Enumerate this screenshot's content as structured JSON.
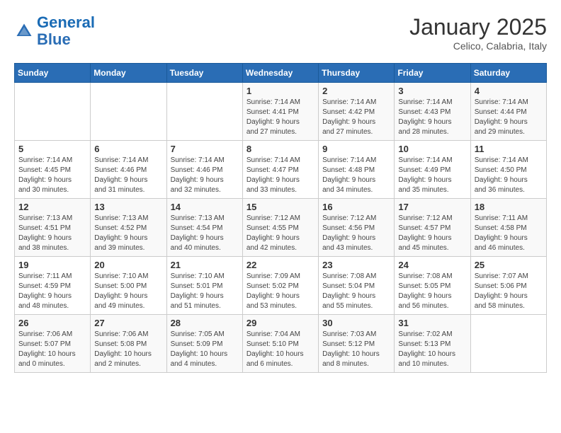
{
  "logo": {
    "line1": "General",
    "line2": "Blue"
  },
  "title": "January 2025",
  "location": "Celico, Calabria, Italy",
  "weekdays": [
    "Sunday",
    "Monday",
    "Tuesday",
    "Wednesday",
    "Thursday",
    "Friday",
    "Saturday"
  ],
  "weeks": [
    [
      {
        "day": "",
        "info": ""
      },
      {
        "day": "",
        "info": ""
      },
      {
        "day": "",
        "info": ""
      },
      {
        "day": "1",
        "info": "Sunrise: 7:14 AM\nSunset: 4:41 PM\nDaylight: 9 hours\nand 27 minutes."
      },
      {
        "day": "2",
        "info": "Sunrise: 7:14 AM\nSunset: 4:42 PM\nDaylight: 9 hours\nand 27 minutes."
      },
      {
        "day": "3",
        "info": "Sunrise: 7:14 AM\nSunset: 4:43 PM\nDaylight: 9 hours\nand 28 minutes."
      },
      {
        "day": "4",
        "info": "Sunrise: 7:14 AM\nSunset: 4:44 PM\nDaylight: 9 hours\nand 29 minutes."
      }
    ],
    [
      {
        "day": "5",
        "info": "Sunrise: 7:14 AM\nSunset: 4:45 PM\nDaylight: 9 hours\nand 30 minutes."
      },
      {
        "day": "6",
        "info": "Sunrise: 7:14 AM\nSunset: 4:46 PM\nDaylight: 9 hours\nand 31 minutes."
      },
      {
        "day": "7",
        "info": "Sunrise: 7:14 AM\nSunset: 4:46 PM\nDaylight: 9 hours\nand 32 minutes."
      },
      {
        "day": "8",
        "info": "Sunrise: 7:14 AM\nSunset: 4:47 PM\nDaylight: 9 hours\nand 33 minutes."
      },
      {
        "day": "9",
        "info": "Sunrise: 7:14 AM\nSunset: 4:48 PM\nDaylight: 9 hours\nand 34 minutes."
      },
      {
        "day": "10",
        "info": "Sunrise: 7:14 AM\nSunset: 4:49 PM\nDaylight: 9 hours\nand 35 minutes."
      },
      {
        "day": "11",
        "info": "Sunrise: 7:14 AM\nSunset: 4:50 PM\nDaylight: 9 hours\nand 36 minutes."
      }
    ],
    [
      {
        "day": "12",
        "info": "Sunrise: 7:13 AM\nSunset: 4:51 PM\nDaylight: 9 hours\nand 38 minutes."
      },
      {
        "day": "13",
        "info": "Sunrise: 7:13 AM\nSunset: 4:52 PM\nDaylight: 9 hours\nand 39 minutes."
      },
      {
        "day": "14",
        "info": "Sunrise: 7:13 AM\nSunset: 4:54 PM\nDaylight: 9 hours\nand 40 minutes."
      },
      {
        "day": "15",
        "info": "Sunrise: 7:12 AM\nSunset: 4:55 PM\nDaylight: 9 hours\nand 42 minutes."
      },
      {
        "day": "16",
        "info": "Sunrise: 7:12 AM\nSunset: 4:56 PM\nDaylight: 9 hours\nand 43 minutes."
      },
      {
        "day": "17",
        "info": "Sunrise: 7:12 AM\nSunset: 4:57 PM\nDaylight: 9 hours\nand 45 minutes."
      },
      {
        "day": "18",
        "info": "Sunrise: 7:11 AM\nSunset: 4:58 PM\nDaylight: 9 hours\nand 46 minutes."
      }
    ],
    [
      {
        "day": "19",
        "info": "Sunrise: 7:11 AM\nSunset: 4:59 PM\nDaylight: 9 hours\nand 48 minutes."
      },
      {
        "day": "20",
        "info": "Sunrise: 7:10 AM\nSunset: 5:00 PM\nDaylight: 9 hours\nand 49 minutes."
      },
      {
        "day": "21",
        "info": "Sunrise: 7:10 AM\nSunset: 5:01 PM\nDaylight: 9 hours\nand 51 minutes."
      },
      {
        "day": "22",
        "info": "Sunrise: 7:09 AM\nSunset: 5:02 PM\nDaylight: 9 hours\nand 53 minutes."
      },
      {
        "day": "23",
        "info": "Sunrise: 7:08 AM\nSunset: 5:04 PM\nDaylight: 9 hours\nand 55 minutes."
      },
      {
        "day": "24",
        "info": "Sunrise: 7:08 AM\nSunset: 5:05 PM\nDaylight: 9 hours\nand 56 minutes."
      },
      {
        "day": "25",
        "info": "Sunrise: 7:07 AM\nSunset: 5:06 PM\nDaylight: 9 hours\nand 58 minutes."
      }
    ],
    [
      {
        "day": "26",
        "info": "Sunrise: 7:06 AM\nSunset: 5:07 PM\nDaylight: 10 hours\nand 0 minutes."
      },
      {
        "day": "27",
        "info": "Sunrise: 7:06 AM\nSunset: 5:08 PM\nDaylight: 10 hours\nand 2 minutes."
      },
      {
        "day": "28",
        "info": "Sunrise: 7:05 AM\nSunset: 5:09 PM\nDaylight: 10 hours\nand 4 minutes."
      },
      {
        "day": "29",
        "info": "Sunrise: 7:04 AM\nSunset: 5:10 PM\nDaylight: 10 hours\nand 6 minutes."
      },
      {
        "day": "30",
        "info": "Sunrise: 7:03 AM\nSunset: 5:12 PM\nDaylight: 10 hours\nand 8 minutes."
      },
      {
        "day": "31",
        "info": "Sunrise: 7:02 AM\nSunset: 5:13 PM\nDaylight: 10 hours\nand 10 minutes."
      },
      {
        "day": "",
        "info": ""
      }
    ]
  ]
}
